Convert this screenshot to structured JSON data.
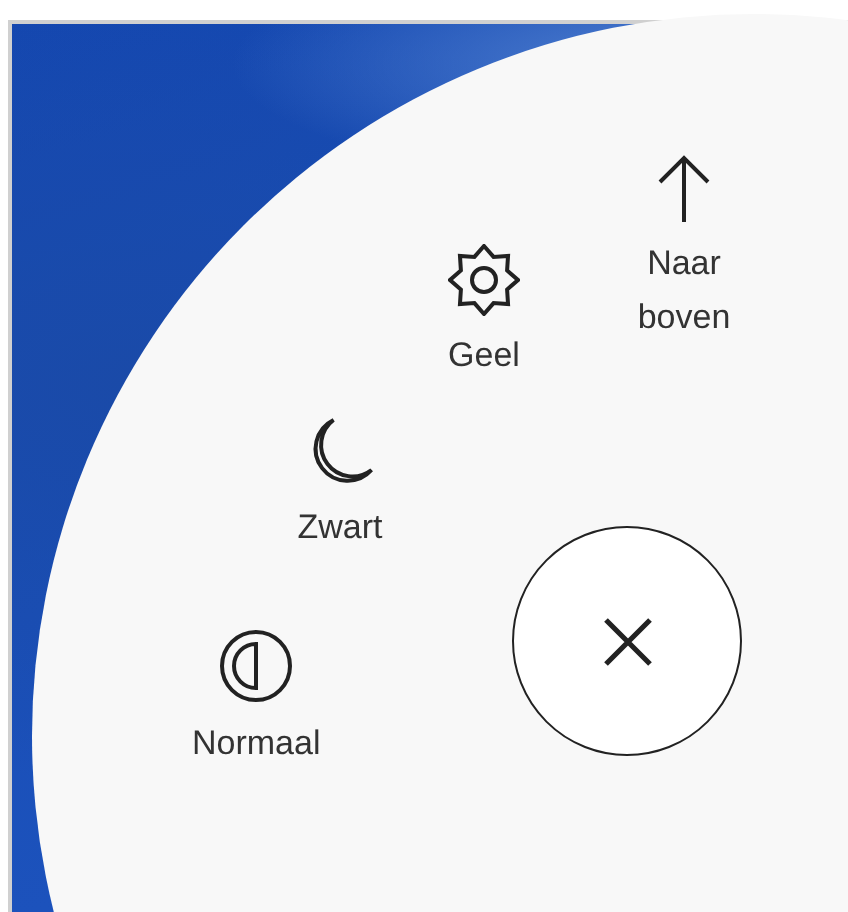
{
  "menu_items": [
    {
      "kind": "up",
      "label": "Naar boven"
    },
    {
      "kind": "sun",
      "label": "Geel"
    },
    {
      "kind": "moon",
      "label": "Zwart"
    },
    {
      "kind": "contrast",
      "label": "Normaal"
    }
  ],
  "close_button": {
    "kind": "close"
  }
}
